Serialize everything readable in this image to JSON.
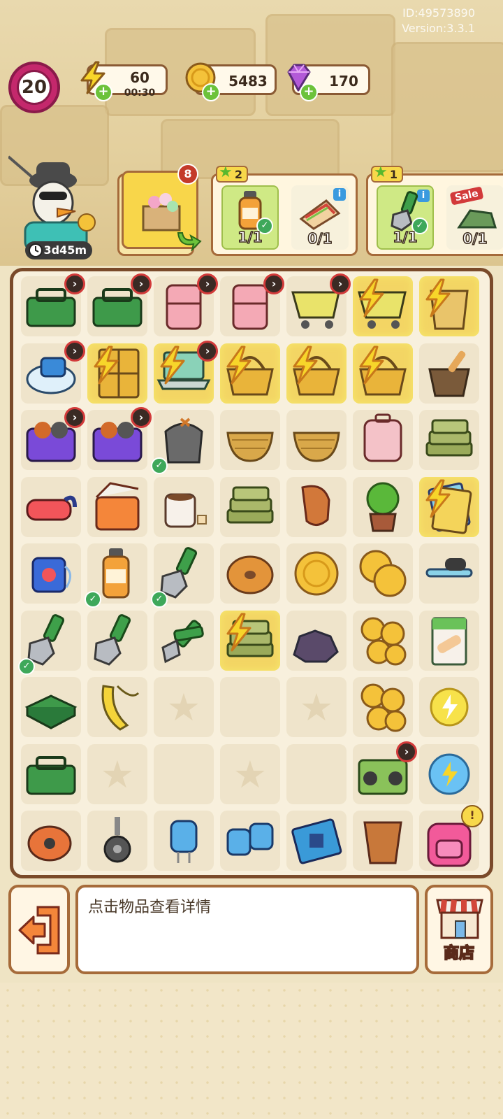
{
  "meta": {
    "id": "ID:49573890",
    "version": "Version:3.3.1"
  },
  "hud": {
    "level": "20",
    "energy": {
      "value": "60",
      "timer": "00:30"
    },
    "coins": {
      "value": "5483"
    },
    "gems": {
      "value": "170"
    }
  },
  "player": {
    "timer": "3d45m"
  },
  "orders": {
    "stack_count": "8",
    "cards": [
      {
        "stars": "2",
        "requirements": [
          {
            "item": "juice-bottle",
            "count": "1/1",
            "done": true
          },
          {
            "item": "sandwich",
            "count": "0/1",
            "done": false
          }
        ]
      },
      {
        "stars": "1",
        "requirements": [
          {
            "item": "wrench",
            "count": "1/1",
            "done": true
          },
          {
            "item": "sale-item",
            "count": "0/1",
            "done": false,
            "tag": "Sale"
          }
        ]
      }
    ]
  },
  "board": {
    "rows": [
      [
        "toolbox-open-locked",
        "toolbox-green-locked",
        "pink-fridge-open-locked",
        "pink-fridge-locked",
        "shopping-cart-blue-locked",
        "shopping-cart-yellow-energy",
        "bucket-energy"
      ],
      [
        "robot-vacuum-locked",
        "golden-cabinet-energy",
        "laptop-energy-locked",
        "basket-yellow-energy",
        "basket-yellow-energy-2",
        "wicker-basket-energy",
        "mortar-bowl"
      ],
      [
        "purple-bag-locked",
        "purple-bag-locked-2",
        "trash-bag-done",
        "wicker-bowl",
        "wicker-bowl-stack",
        "pink-suitcase",
        "green-stack"
      ],
      [
        "vr-headset",
        "orange-cooler",
        "hot-cocoa",
        "green-cloth-stack",
        "clay-pot",
        "potted-tree",
        "card-pack-energy"
      ],
      [
        "blue-mp3-player",
        "juice-bottle-done",
        "wrench-done",
        "bagel",
        "coin-1",
        "coin-2",
        "dumbbell"
      ],
      [
        "wrench-done-2",
        "adjustable-wrench",
        "pliers",
        "green-bag-energy",
        "coal",
        "coin-stack-3",
        "bandage-box"
      ],
      [
        "green-box-closed",
        "banana-peel",
        "empty-star",
        "empty",
        "empty-star",
        "coin-stack-5",
        "lightning-coin"
      ],
      [
        "green-toolbox",
        "empty-star",
        "empty",
        "empty-star",
        "empty",
        "radio-locked",
        "energy-orb"
      ],
      [
        "tape-measure",
        "caster-wheel",
        "capacitor",
        "capacitor-pair",
        "circuit-board",
        "clay-cup",
        "pink-backpack-alert"
      ]
    ]
  },
  "description": {
    "text": "点击物品查看详情"
  },
  "shop": {
    "label": "商店"
  }
}
